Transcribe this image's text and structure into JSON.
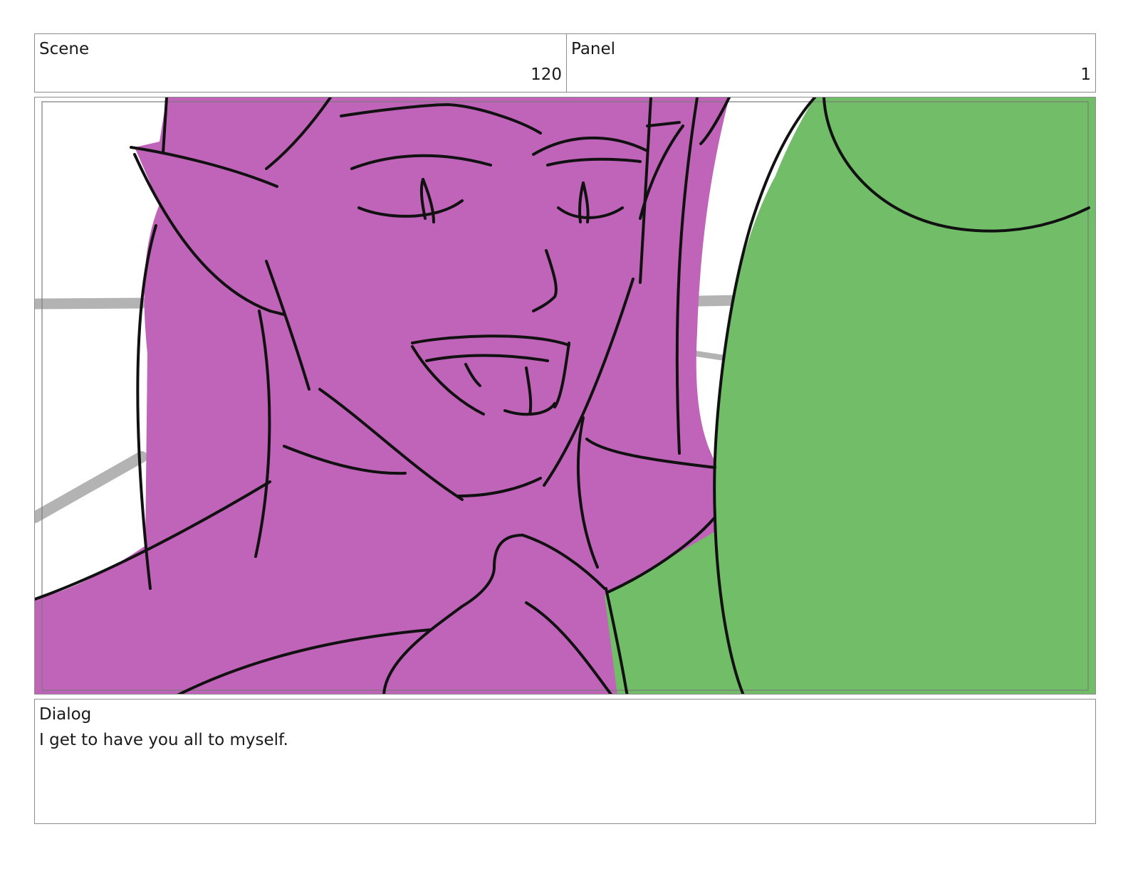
{
  "header": {
    "scene_label": "Scene",
    "scene_value": "120",
    "panel_label": "Panel",
    "panel_value": "1"
  },
  "dialog": {
    "label": "Dialog",
    "text": "I get to have you all to myself."
  },
  "colors": {
    "character_fill": "#bf64b8",
    "foreground_fill": "#72bd68",
    "line": "#111111",
    "background_lines": "#b3b3b3"
  }
}
